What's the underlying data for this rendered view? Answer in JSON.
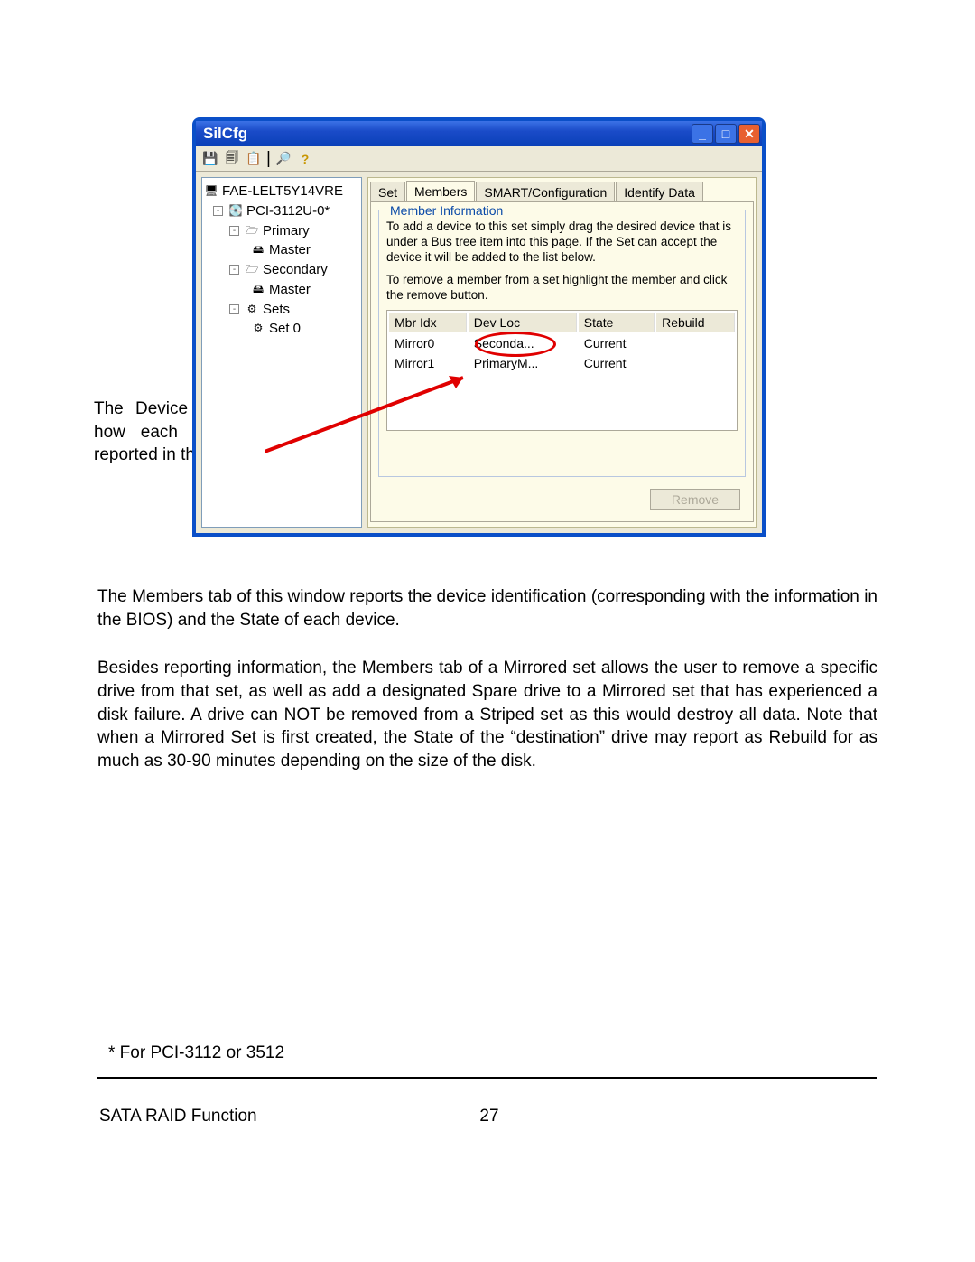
{
  "callout": "The Device Location refers to how each physical disk was reported in the BIOS RAID utility.",
  "window": {
    "title": "SilCfg",
    "toolbar_icons": [
      "save-icon",
      "copy-icon",
      "paste-icon",
      "find-icon",
      "help-icon"
    ],
    "tree": {
      "root": "FAE-LELT5Y14VRE",
      "card": "PCI-3112U-0*",
      "primary": "Primary",
      "primary_master": "Master",
      "secondary": "Secondary",
      "secondary_master": "Master",
      "sets_label": "Sets",
      "set0": "Set 0"
    },
    "tabs": {
      "set": "Set",
      "members": "Members",
      "smart": "SMART/Configuration",
      "identify": "Identify Data"
    },
    "fieldset_title": "Member Information",
    "info1": "To add a device to this set simply drag the desired device that is under a Bus tree item into this page.  If the Set can accept the device it will be added to the list below.",
    "info2": "To remove a member from a set highlight the member and click the remove button.",
    "columns": {
      "mbr": "Mbr Idx",
      "dev": "Dev Loc",
      "state": "State",
      "rebuild": "Rebuild"
    },
    "rows": [
      {
        "mbr": "Mirror0",
        "dev": "Seconda...",
        "state": "Current",
        "rebuild": ""
      },
      {
        "mbr": "Mirror1",
        "dev": "PrimaryM...",
        "state": "Current",
        "rebuild": ""
      }
    ],
    "remove_label": "Remove"
  },
  "para1": "The Members tab of this window reports the device identification (corresponding with the information in the BIOS) and the State of each device.",
  "para2": "Besides reporting information, the Members tab of a Mirrored set allows the user to remove a specific drive from that set, as well as add a designated Spare drive to a Mirrored set that has experienced a disk failure. A drive can NOT be removed from a Striped set as this would destroy all data. Note that when a Mirrored Set is first created, the State of the “destination” drive may report as Rebuild for as much as 30-90 minutes depending on the size of the disk.",
  "footnote": "* For PCI-3112 or 3512",
  "footer_left": "SATA RAID Function",
  "page_number": "27"
}
